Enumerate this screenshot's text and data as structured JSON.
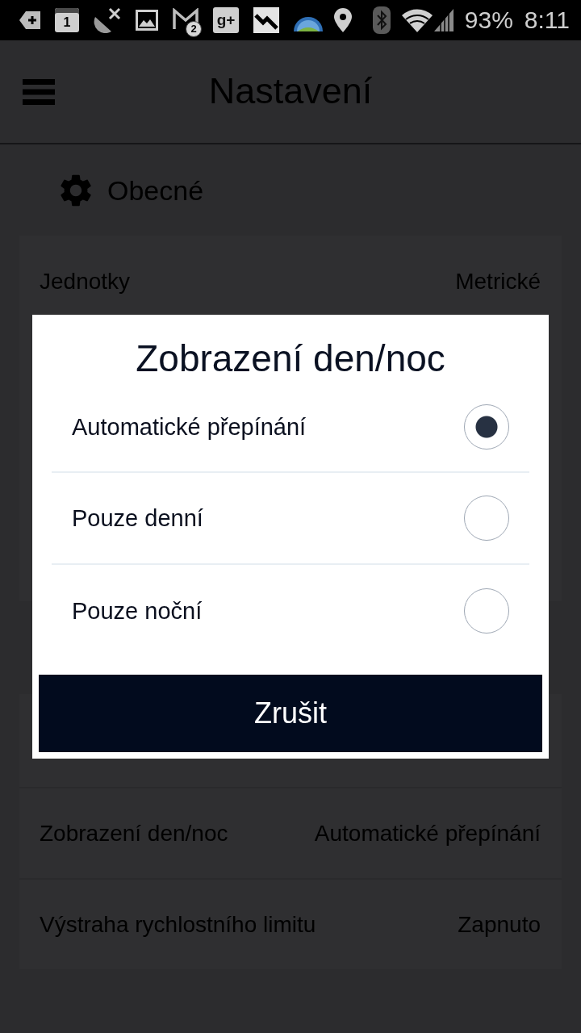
{
  "status_bar": {
    "notifications": [
      {
        "kind": "tag-plus"
      },
      {
        "kind": "calendar",
        "text": "1"
      },
      {
        "kind": "dish-off"
      },
      {
        "kind": "image"
      },
      {
        "kind": "mail",
        "badge": "2"
      },
      {
        "kind": "tile-text",
        "text": "g+"
      },
      {
        "kind": "zigzag-tile"
      },
      {
        "kind": "globe-dome"
      }
    ],
    "system": [
      {
        "kind": "location"
      },
      {
        "kind": "bluetooth"
      },
      {
        "kind": "wifi"
      },
      {
        "kind": "signal"
      }
    ],
    "battery": "93%",
    "time": "8:11"
  },
  "app_bar": {
    "title": "Nastavení"
  },
  "sections": [
    {
      "title": "Obecné",
      "rows": [
        {
          "label": "Jednotky",
          "value": "Metrické"
        }
      ]
    },
    {
      "rows": [
        {
          "label": "Zobrazení den/noc",
          "value": "Automatické přepínání"
        },
        {
          "label": "Výstraha rychlostního limitu",
          "value": "Zapnuto"
        }
      ]
    }
  ],
  "dialog": {
    "title": "Zobrazení den/noc",
    "options": [
      {
        "label": "Automatické přepínání",
        "selected": true
      },
      {
        "label": "Pouze denní",
        "selected": false
      },
      {
        "label": "Pouze noční",
        "selected": false
      }
    ],
    "button": "Zrušit"
  }
}
